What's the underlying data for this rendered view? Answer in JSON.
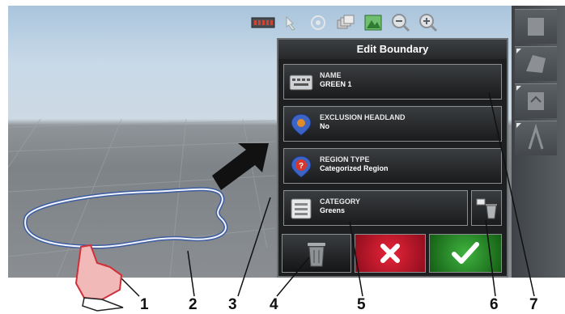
{
  "panel": {
    "title": "Edit Boundary",
    "name": {
      "label": "NAME",
      "value": "GREEN 1"
    },
    "exclusion": {
      "label": "EXCLUSION HEADLAND",
      "value": "No"
    },
    "region": {
      "label": "REGION TYPE",
      "value": "Categorized Region"
    },
    "category": {
      "label": "CATEGORY",
      "value": "Greens"
    }
  },
  "callouts": [
    "1",
    "2",
    "3",
    "4",
    "5",
    "6",
    "7"
  ],
  "colors": {
    "cancel": "#c8102e",
    "confirm": "#2e8b2e",
    "boundary": "#dfe6ff"
  }
}
